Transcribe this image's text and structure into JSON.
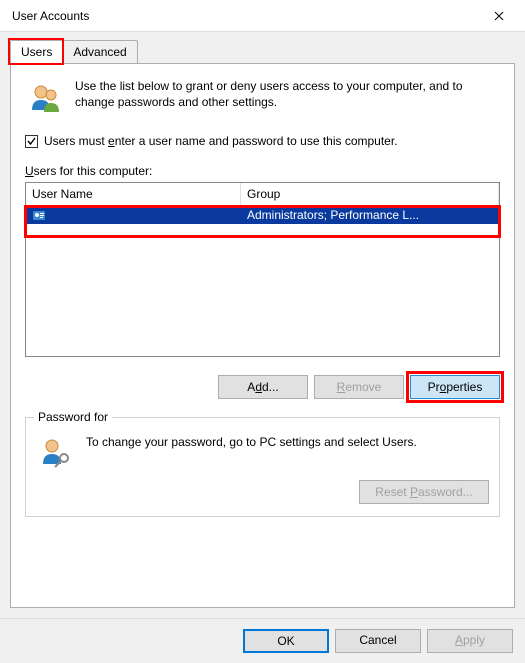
{
  "title": "User Accounts",
  "tabs": {
    "users": "Users",
    "advanced": "Advanced"
  },
  "intro": "Use the list below to grant or deny users access to your computer, and to change passwords and other settings.",
  "checkbox": {
    "prefix": "Users must ",
    "hot": "e",
    "rest": "nter a user name and password to use this computer."
  },
  "list_label": {
    "hot": "U",
    "rest": "sers for this computer:"
  },
  "columns": {
    "name": "User Name",
    "group": "Group"
  },
  "rows": [
    {
      "name": "",
      "group": "Administrators; Performance L..."
    }
  ],
  "buttons": {
    "add": {
      "pre": "A",
      "hot": "d",
      "post": "d..."
    },
    "remove": {
      "hot": "R",
      "rest": "emove"
    },
    "properties": {
      "pre": "Pr",
      "hot": "o",
      "post": "perties"
    }
  },
  "pw": {
    "legend": "Password for",
    "text": "To change your password, go to PC settings and select Users.",
    "reset": {
      "pre": "Reset ",
      "hot": "P",
      "post": "assword..."
    }
  },
  "footer": {
    "ok": "OK",
    "cancel": "Cancel",
    "apply": {
      "hot": "A",
      "rest": "pply"
    }
  }
}
